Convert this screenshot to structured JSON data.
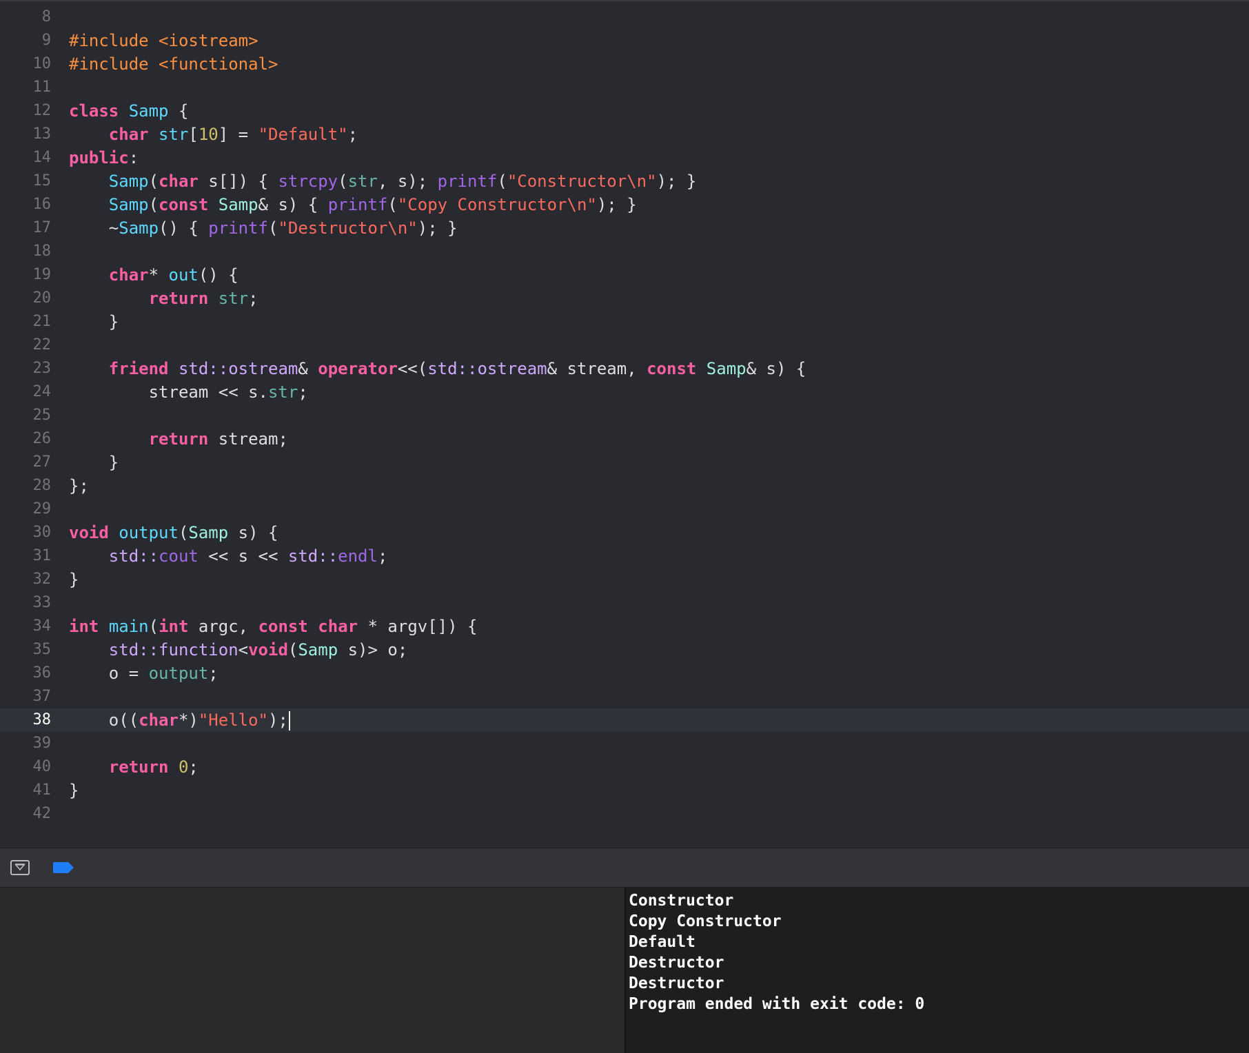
{
  "editor": {
    "current_line": "38",
    "lines": [
      {
        "num": "8",
        "tokens": []
      },
      {
        "num": "9",
        "tokens": [
          {
            "c": "pp",
            "t": "#include <iostream>"
          }
        ]
      },
      {
        "num": "10",
        "tokens": [
          {
            "c": "pp",
            "t": "#include <functional>"
          }
        ]
      },
      {
        "num": "11",
        "tokens": []
      },
      {
        "num": "12",
        "tokens": [
          {
            "c": "kw",
            "t": "class"
          },
          {
            "c": "plain",
            "t": " "
          },
          {
            "c": "ty",
            "t": "Samp"
          },
          {
            "c": "plain",
            "t": " {"
          }
        ]
      },
      {
        "num": "13",
        "tokens": [
          {
            "c": "plain",
            "t": "    "
          },
          {
            "c": "kw",
            "t": "char"
          },
          {
            "c": "plain",
            "t": " "
          },
          {
            "c": "ty",
            "t": "str"
          },
          {
            "c": "plain",
            "t": "["
          },
          {
            "c": "num",
            "t": "10"
          },
          {
            "c": "plain",
            "t": "] = "
          },
          {
            "c": "str",
            "t": "\"Default\""
          },
          {
            "c": "plain",
            "t": ";"
          }
        ]
      },
      {
        "num": "14",
        "tokens": [
          {
            "c": "kw",
            "t": "public"
          },
          {
            "c": "plain",
            "t": ":"
          }
        ]
      },
      {
        "num": "15",
        "tokens": [
          {
            "c": "plain",
            "t": "    "
          },
          {
            "c": "ty",
            "t": "Samp"
          },
          {
            "c": "plain",
            "t": "("
          },
          {
            "c": "kw",
            "t": "char"
          },
          {
            "c": "plain",
            "t": " s[]) { "
          },
          {
            "c": "lib",
            "t": "strcpy"
          },
          {
            "c": "plain",
            "t": "("
          },
          {
            "c": "fn",
            "t": "str"
          },
          {
            "c": "plain",
            "t": ", s); "
          },
          {
            "c": "lib",
            "t": "printf"
          },
          {
            "c": "plain",
            "t": "("
          },
          {
            "c": "str",
            "t": "\"Constructor\\n\""
          },
          {
            "c": "plain",
            "t": "); }"
          }
        ]
      },
      {
        "num": "16",
        "tokens": [
          {
            "c": "plain",
            "t": "    "
          },
          {
            "c": "ty",
            "t": "Samp"
          },
          {
            "c": "plain",
            "t": "("
          },
          {
            "c": "kw",
            "t": "const"
          },
          {
            "c": "plain",
            "t": " "
          },
          {
            "c": "uty",
            "t": "Samp"
          },
          {
            "c": "plain",
            "t": "& s) { "
          },
          {
            "c": "lib",
            "t": "printf"
          },
          {
            "c": "plain",
            "t": "("
          },
          {
            "c": "str",
            "t": "\"Copy Constructor\\n\""
          },
          {
            "c": "plain",
            "t": "); }"
          }
        ]
      },
      {
        "num": "17",
        "tokens": [
          {
            "c": "plain",
            "t": "    ~"
          },
          {
            "c": "ty",
            "t": "Samp"
          },
          {
            "c": "plain",
            "t": "() { "
          },
          {
            "c": "lib",
            "t": "printf"
          },
          {
            "c": "plain",
            "t": "("
          },
          {
            "c": "str",
            "t": "\"Destructor\\n\""
          },
          {
            "c": "plain",
            "t": "); }"
          }
        ]
      },
      {
        "num": "18",
        "tokens": []
      },
      {
        "num": "19",
        "tokens": [
          {
            "c": "plain",
            "t": "    "
          },
          {
            "c": "kw",
            "t": "char"
          },
          {
            "c": "plain",
            "t": "* "
          },
          {
            "c": "ty",
            "t": "out"
          },
          {
            "c": "plain",
            "t": "() {"
          }
        ]
      },
      {
        "num": "20",
        "tokens": [
          {
            "c": "plain",
            "t": "        "
          },
          {
            "c": "kw",
            "t": "return"
          },
          {
            "c": "plain",
            "t": " "
          },
          {
            "c": "fn",
            "t": "str"
          },
          {
            "c": "plain",
            "t": ";"
          }
        ]
      },
      {
        "num": "21",
        "tokens": [
          {
            "c": "plain",
            "t": "    }"
          }
        ]
      },
      {
        "num": "22",
        "tokens": []
      },
      {
        "num": "23",
        "tokens": [
          {
            "c": "plain",
            "t": "    "
          },
          {
            "c": "kw",
            "t": "friend"
          },
          {
            "c": "plain",
            "t": " "
          },
          {
            "c": "libt",
            "t": "std::ostream"
          },
          {
            "c": "plain",
            "t": "& "
          },
          {
            "c": "kw",
            "t": "operator"
          },
          {
            "c": "plain",
            "t": "<<("
          },
          {
            "c": "libt",
            "t": "std::ostream"
          },
          {
            "c": "plain",
            "t": "& stream, "
          },
          {
            "c": "kw",
            "t": "const"
          },
          {
            "c": "plain",
            "t": " "
          },
          {
            "c": "uty",
            "t": "Samp"
          },
          {
            "c": "plain",
            "t": "& s) {"
          }
        ]
      },
      {
        "num": "24",
        "tokens": [
          {
            "c": "plain",
            "t": "        stream << s."
          },
          {
            "c": "fn",
            "t": "str"
          },
          {
            "c": "plain",
            "t": ";"
          }
        ]
      },
      {
        "num": "25",
        "tokens": []
      },
      {
        "num": "26",
        "tokens": [
          {
            "c": "plain",
            "t": "        "
          },
          {
            "c": "kw",
            "t": "return"
          },
          {
            "c": "plain",
            "t": " stream;"
          }
        ]
      },
      {
        "num": "27",
        "tokens": [
          {
            "c": "plain",
            "t": "    }"
          }
        ]
      },
      {
        "num": "28",
        "tokens": [
          {
            "c": "plain",
            "t": "};"
          }
        ]
      },
      {
        "num": "29",
        "tokens": []
      },
      {
        "num": "30",
        "tokens": [
          {
            "c": "kw",
            "t": "void"
          },
          {
            "c": "plain",
            "t": " "
          },
          {
            "c": "ty",
            "t": "output"
          },
          {
            "c": "plain",
            "t": "("
          },
          {
            "c": "uty",
            "t": "Samp"
          },
          {
            "c": "plain",
            "t": " s) {"
          }
        ]
      },
      {
        "num": "31",
        "tokens": [
          {
            "c": "plain",
            "t": "    "
          },
          {
            "c": "libt",
            "t": "std::"
          },
          {
            "c": "lib",
            "t": "cout"
          },
          {
            "c": "plain",
            "t": " << s << "
          },
          {
            "c": "libt",
            "t": "std::"
          },
          {
            "c": "lib",
            "t": "endl"
          },
          {
            "c": "plain",
            "t": ";"
          }
        ]
      },
      {
        "num": "32",
        "tokens": [
          {
            "c": "plain",
            "t": "}"
          }
        ]
      },
      {
        "num": "33",
        "tokens": []
      },
      {
        "num": "34",
        "tokens": [
          {
            "c": "kw",
            "t": "int"
          },
          {
            "c": "plain",
            "t": " "
          },
          {
            "c": "ty",
            "t": "main"
          },
          {
            "c": "plain",
            "t": "("
          },
          {
            "c": "kw",
            "t": "int"
          },
          {
            "c": "plain",
            "t": " argc, "
          },
          {
            "c": "kw",
            "t": "const"
          },
          {
            "c": "plain",
            "t": " "
          },
          {
            "c": "kw",
            "t": "char"
          },
          {
            "c": "plain",
            "t": " * argv[]) {"
          }
        ]
      },
      {
        "num": "35",
        "tokens": [
          {
            "c": "plain",
            "t": "    "
          },
          {
            "c": "libt",
            "t": "std::function"
          },
          {
            "c": "plain",
            "t": "<"
          },
          {
            "c": "kw",
            "t": "void"
          },
          {
            "c": "plain",
            "t": "("
          },
          {
            "c": "uty",
            "t": "Samp"
          },
          {
            "c": "plain",
            "t": " s)> o;"
          }
        ]
      },
      {
        "num": "36",
        "tokens": [
          {
            "c": "plain",
            "t": "    o = "
          },
          {
            "c": "fn",
            "t": "output"
          },
          {
            "c": "plain",
            "t": ";"
          }
        ]
      },
      {
        "num": "37",
        "tokens": []
      },
      {
        "num": "38",
        "tokens": [
          {
            "c": "plain",
            "t": "    o(("
          },
          {
            "c": "kw",
            "t": "char"
          },
          {
            "c": "plain",
            "t": "*)"
          },
          {
            "c": "str",
            "t": "\"Hello\""
          },
          {
            "c": "plain",
            "t": ");"
          }
        ]
      },
      {
        "num": "39",
        "tokens": []
      },
      {
        "num": "40",
        "tokens": [
          {
            "c": "plain",
            "t": "    "
          },
          {
            "c": "kw",
            "t": "return"
          },
          {
            "c": "plain",
            "t": " "
          },
          {
            "c": "num",
            "t": "0"
          },
          {
            "c": "plain",
            "t": ";"
          }
        ]
      },
      {
        "num": "41",
        "tokens": [
          {
            "c": "plain",
            "t": "}"
          }
        ]
      },
      {
        "num": "42",
        "tokens": []
      }
    ]
  },
  "debug_bar": {
    "toggle_icon": "hide-debug-area-icon",
    "breakpoint_icon": "breakpoint-icon",
    "breakpoint_color": "#1f7ef6"
  },
  "console": {
    "output_lines": [
      "Constructor",
      "Copy Constructor",
      "Default",
      "Destructor",
      "Destructor",
      "Program ended with exit code: 0"
    ]
  }
}
